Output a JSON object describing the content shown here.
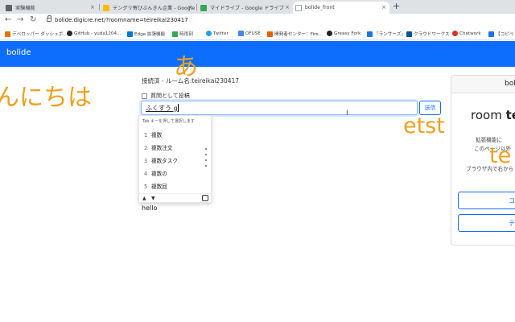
{
  "browser": {
    "tabs": [
      {
        "title": "実験機能",
        "icon_color": "#5f6368"
      },
      {
        "title": "テングリ寄びぶんきん企業 - Google",
        "icon_color": "#fbbc04"
      },
      {
        "title": "マイドライブ - Google ドライブ",
        "icon_color": "#34a853"
      },
      {
        "title": "bolide_front",
        "icon_color": "#9aa0a6",
        "active": true
      }
    ],
    "new_tab_glyph": "+",
    "tab_close_glyph": "×",
    "back_glyph": "←",
    "forward_glyph": "→",
    "reload_glyph": "↻",
    "url": "bolide.digicre.net/?roomname=teireikai230417",
    "bookmarks": [
      {
        "label": "デベロッパー ダッシュボ...",
        "color": "#e8710a"
      },
      {
        "label": "GitHub - yuda1204...",
        "color": "#24292e"
      },
      {
        "label": "Edge 拡張機能",
        "color": "#0078d4"
      },
      {
        "label": "時雨刻",
        "color": "#34a853"
      },
      {
        "label": "Twitter",
        "color": "#1da1f2"
      },
      {
        "label": "OFUSE",
        "color": "#4285f4"
      },
      {
        "label": "開発者センター：Fire...",
        "color": "#e66000"
      },
      {
        "label": "Greasy Fork",
        "color": "#222222"
      },
      {
        "label": "「ランサーズ」",
        "color": "#1a73e8"
      },
      {
        "label": "クラウドワークス",
        "color": "#0b5394"
      },
      {
        "label": "Chatwork",
        "color": "#d93025"
      },
      {
        "label": "【コピペ",
        "color": "#1a73e8"
      }
    ]
  },
  "app": {
    "brand": "bolide",
    "status_text": "接続済 - ルーム名:teireikai230417",
    "anonymous_label": "質問として投稿",
    "input_value": "ふくすう g",
    "send_label": "送信",
    "ime": {
      "hint": "Tab キーを押して選択します",
      "candidates": [
        {
          "num": "1",
          "text": "複数"
        },
        {
          "num": "2",
          "text": "複数注文"
        },
        {
          "num": "3",
          "text": "複数タスク"
        },
        {
          "num": "4",
          "text": "複数の"
        },
        {
          "num": "5",
          "text": "複数回"
        }
      ],
      "prev_glyph": "▲",
      "next_glyph": "▼"
    },
    "messages": [
      "hello"
    ],
    "card": {
      "header": "bolic",
      "room_prefix": "room",
      "room_name": "te",
      "lines": [
        "拡張機能に",
        "このページ以外",
        "ブラウザ内で右から"
      ],
      "buttons": [
        "コ",
        "テ"
      ]
    }
  },
  "overlay": {
    "texts": [
      "あ",
      "んにちは",
      "etst",
      "te"
    ],
    "color": "#f0a01e"
  },
  "colors": {
    "navbar": "#0d6efd",
    "tabstrip": "#dee1e6",
    "focus": "#86b7fe"
  }
}
